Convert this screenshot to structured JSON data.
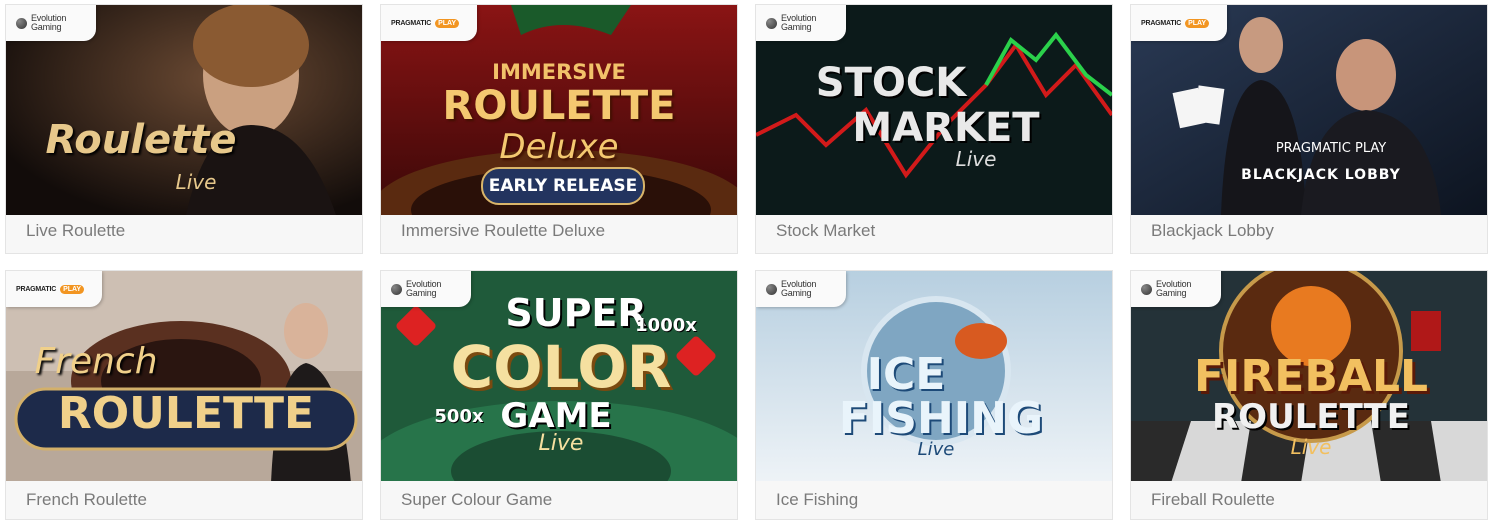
{
  "games": [
    {
      "title": "Live Roulette",
      "provider": "Evolution Gaming",
      "art_lines": [
        "Roulette",
        "Live"
      ]
    },
    {
      "title": "Immersive Roulette Deluxe",
      "provider": "Pragmatic Play",
      "art_lines": [
        "IMMERSIVE",
        "ROULETTE",
        "Deluxe",
        "EARLY RELEASE"
      ]
    },
    {
      "title": "Stock Market",
      "provider": "Evolution Gaming",
      "art_lines": [
        "STOCK",
        "MARKET",
        "Live"
      ]
    },
    {
      "title": "Blackjack Lobby",
      "provider": "Pragmatic Play",
      "art_lines": [
        "PRAGMATIC PLAY",
        "BLACKJACK LOBBY"
      ]
    },
    {
      "title": "French Roulette",
      "provider": "Pragmatic Play",
      "art_lines": [
        "French",
        "ROULETTE"
      ]
    },
    {
      "title": "Super Colour Game",
      "provider": "Evolution Gaming",
      "art_lines": [
        "SUPER",
        "COLOR",
        "GAME",
        "Live",
        "1000x",
        "500x"
      ]
    },
    {
      "title": "Ice Fishing",
      "provider": "Evolution Gaming",
      "art_lines": [
        "ICE",
        "FISHING",
        "Live"
      ]
    },
    {
      "title": "Fireball Roulette",
      "provider": "Evolution Gaming",
      "art_lines": [
        "FIREBALL",
        "ROULETTE",
        "Live"
      ]
    }
  ],
  "provider_logos": {
    "evolution": {
      "line1": "Evolution",
      "line2": "Gaming"
    },
    "pragmatic": {
      "word": "PRAGMATIC",
      "play": "PLAY"
    }
  },
  "colors": {
    "caption": "#7a7a7a",
    "card_bg": "#f7f7f7",
    "pragmatic_orange": "#f29521"
  }
}
